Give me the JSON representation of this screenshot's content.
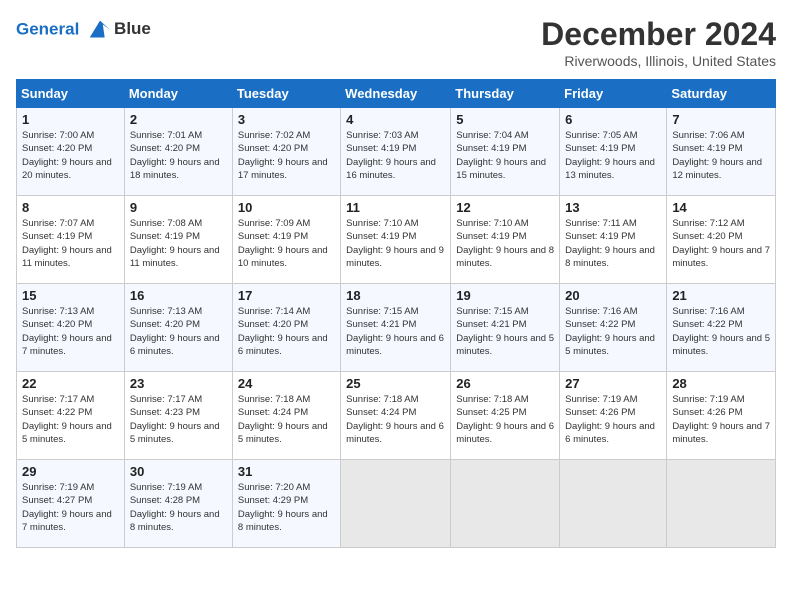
{
  "header": {
    "logo_line1": "General",
    "logo_line2": "Blue",
    "month": "December 2024",
    "location": "Riverwoods, Illinois, United States"
  },
  "weekdays": [
    "Sunday",
    "Monday",
    "Tuesday",
    "Wednesday",
    "Thursday",
    "Friday",
    "Saturday"
  ],
  "weeks": [
    [
      {
        "day": "1",
        "sunrise": "7:00 AM",
        "sunset": "4:20 PM",
        "daylight": "9 hours and 20 minutes."
      },
      {
        "day": "2",
        "sunrise": "7:01 AM",
        "sunset": "4:20 PM",
        "daylight": "9 hours and 18 minutes."
      },
      {
        "day": "3",
        "sunrise": "7:02 AM",
        "sunset": "4:20 PM",
        "daylight": "9 hours and 17 minutes."
      },
      {
        "day": "4",
        "sunrise": "7:03 AM",
        "sunset": "4:19 PM",
        "daylight": "9 hours and 16 minutes."
      },
      {
        "day": "5",
        "sunrise": "7:04 AM",
        "sunset": "4:19 PM",
        "daylight": "9 hours and 15 minutes."
      },
      {
        "day": "6",
        "sunrise": "7:05 AM",
        "sunset": "4:19 PM",
        "daylight": "9 hours and 13 minutes."
      },
      {
        "day": "7",
        "sunrise": "7:06 AM",
        "sunset": "4:19 PM",
        "daylight": "9 hours and 12 minutes."
      }
    ],
    [
      {
        "day": "8",
        "sunrise": "7:07 AM",
        "sunset": "4:19 PM",
        "daylight": "9 hours and 11 minutes."
      },
      {
        "day": "9",
        "sunrise": "7:08 AM",
        "sunset": "4:19 PM",
        "daylight": "9 hours and 11 minutes."
      },
      {
        "day": "10",
        "sunrise": "7:09 AM",
        "sunset": "4:19 PM",
        "daylight": "9 hours and 10 minutes."
      },
      {
        "day": "11",
        "sunrise": "7:10 AM",
        "sunset": "4:19 PM",
        "daylight": "9 hours and 9 minutes."
      },
      {
        "day": "12",
        "sunrise": "7:10 AM",
        "sunset": "4:19 PM",
        "daylight": "9 hours and 8 minutes."
      },
      {
        "day": "13",
        "sunrise": "7:11 AM",
        "sunset": "4:19 PM",
        "daylight": "9 hours and 8 minutes."
      },
      {
        "day": "14",
        "sunrise": "7:12 AM",
        "sunset": "4:20 PM",
        "daylight": "9 hours and 7 minutes."
      }
    ],
    [
      {
        "day": "15",
        "sunrise": "7:13 AM",
        "sunset": "4:20 PM",
        "daylight": "9 hours and 7 minutes."
      },
      {
        "day": "16",
        "sunrise": "7:13 AM",
        "sunset": "4:20 PM",
        "daylight": "9 hours and 6 minutes."
      },
      {
        "day": "17",
        "sunrise": "7:14 AM",
        "sunset": "4:20 PM",
        "daylight": "9 hours and 6 minutes."
      },
      {
        "day": "18",
        "sunrise": "7:15 AM",
        "sunset": "4:21 PM",
        "daylight": "9 hours and 6 minutes."
      },
      {
        "day": "19",
        "sunrise": "7:15 AM",
        "sunset": "4:21 PM",
        "daylight": "9 hours and 5 minutes."
      },
      {
        "day": "20",
        "sunrise": "7:16 AM",
        "sunset": "4:22 PM",
        "daylight": "9 hours and 5 minutes."
      },
      {
        "day": "21",
        "sunrise": "7:16 AM",
        "sunset": "4:22 PM",
        "daylight": "9 hours and 5 minutes."
      }
    ],
    [
      {
        "day": "22",
        "sunrise": "7:17 AM",
        "sunset": "4:22 PM",
        "daylight": "9 hours and 5 minutes."
      },
      {
        "day": "23",
        "sunrise": "7:17 AM",
        "sunset": "4:23 PM",
        "daylight": "9 hours and 5 minutes."
      },
      {
        "day": "24",
        "sunrise": "7:18 AM",
        "sunset": "4:24 PM",
        "daylight": "9 hours and 5 minutes."
      },
      {
        "day": "25",
        "sunrise": "7:18 AM",
        "sunset": "4:24 PM",
        "daylight": "9 hours and 6 minutes."
      },
      {
        "day": "26",
        "sunrise": "7:18 AM",
        "sunset": "4:25 PM",
        "daylight": "9 hours and 6 minutes."
      },
      {
        "day": "27",
        "sunrise": "7:19 AM",
        "sunset": "4:26 PM",
        "daylight": "9 hours and 6 minutes."
      },
      {
        "day": "28",
        "sunrise": "7:19 AM",
        "sunset": "4:26 PM",
        "daylight": "9 hours and 7 minutes."
      }
    ],
    [
      {
        "day": "29",
        "sunrise": "7:19 AM",
        "sunset": "4:27 PM",
        "daylight": "9 hours and 7 minutes."
      },
      {
        "day": "30",
        "sunrise": "7:19 AM",
        "sunset": "4:28 PM",
        "daylight": "9 hours and 8 minutes."
      },
      {
        "day": "31",
        "sunrise": "7:20 AM",
        "sunset": "4:29 PM",
        "daylight": "9 hours and 8 minutes."
      },
      null,
      null,
      null,
      null
    ]
  ]
}
